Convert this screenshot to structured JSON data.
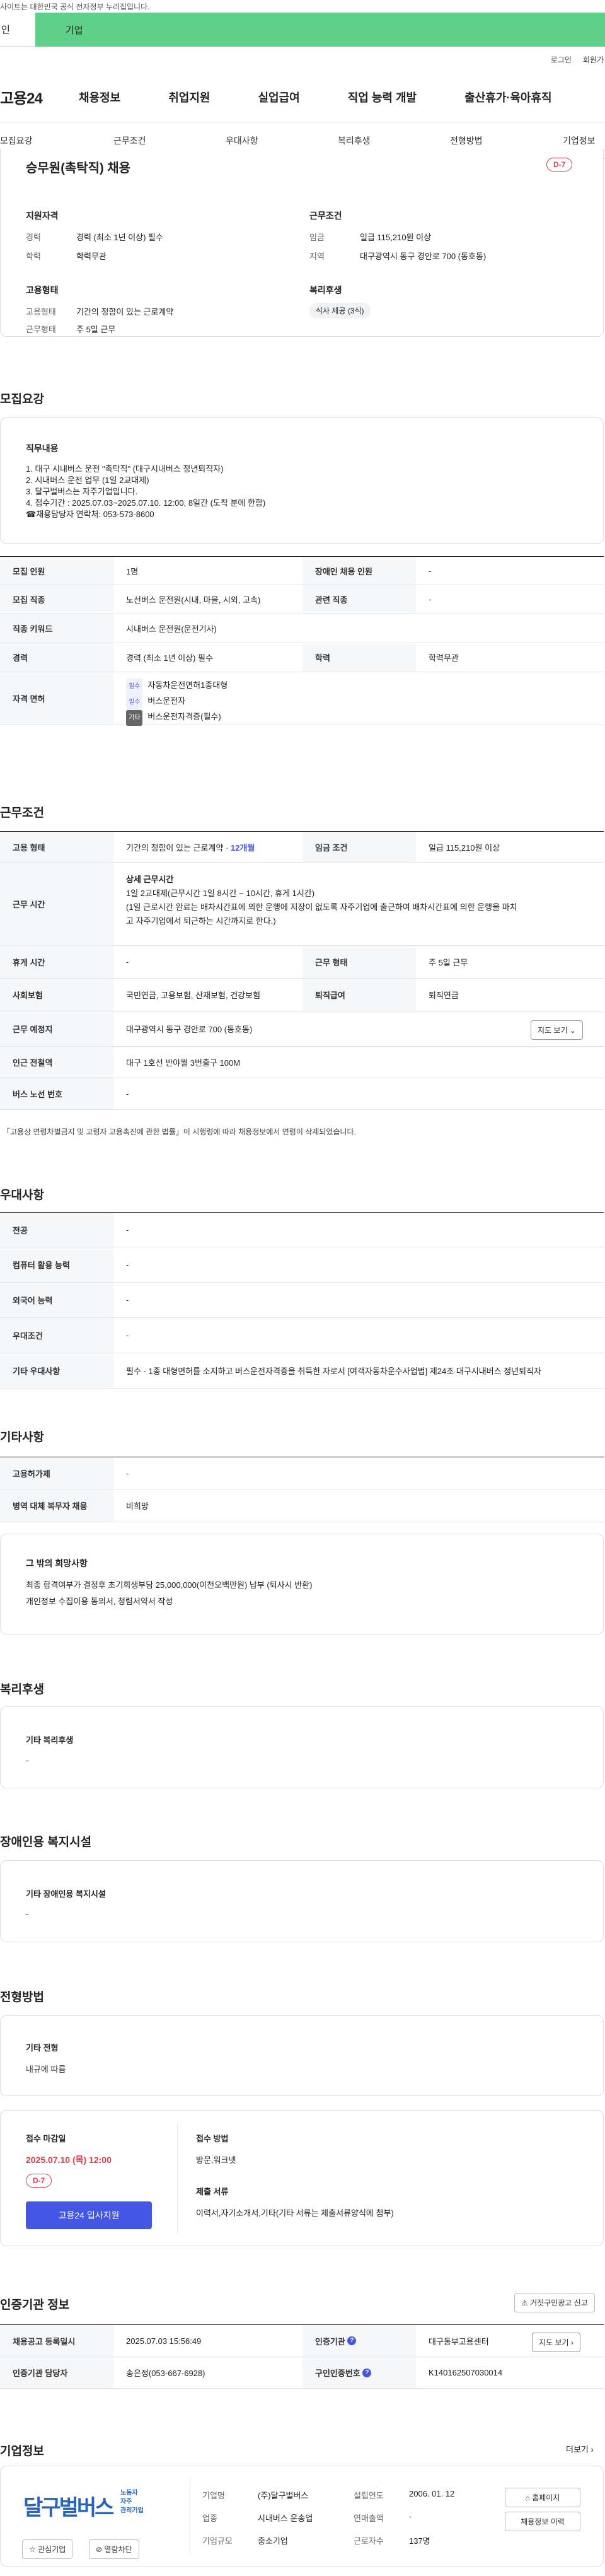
{
  "topbar": {
    "notice": "사이트는 대한민국 공식 전자정부 누리집입니다."
  },
  "sitebar": {
    "left": "인",
    "right": "기업"
  },
  "util": {
    "login": "로그인",
    "join": "회원가"
  },
  "gnb": {
    "logo": "고용24",
    "items": [
      "채용정보",
      "취업지원",
      "실업급여",
      "직업 능력 개발",
      "출산휴가·육아휴직"
    ]
  },
  "tabs": [
    "모집요강",
    "근무조건",
    "우대사항",
    "복리후생",
    "전형방법",
    "기업정보"
  ],
  "summary": {
    "title": "승무원(촉탁직) 채용",
    "dday": "D-7",
    "qual_title": "지원자격",
    "career_label": "경력",
    "career": "경력 (최소 1년 이상) 필수",
    "edu_label": "학력",
    "edu": "학력무관",
    "cond_title": "근무조건",
    "wage_label": "임금",
    "wage": "일급 115,210원 이상",
    "region_label": "지역",
    "region": "대구광역시 동구 경안로 700 (동호동)",
    "emp_title": "고용형태",
    "emp_type_label": "고용형태",
    "emp_type": "기간의 정함이 있는 근로계약",
    "work_label": "근무형태",
    "work": "주 5일 근무",
    "welfare_title": "복리후생",
    "welfare_chip": "식사 제공 (3식)"
  },
  "recruit": {
    "heading": "모집요강",
    "duty_title": "직무내용",
    "duty_lines": [
      "1. 대구 시내버스 운전 \"촉탁직\" (대구시내버스 정년퇴직자)",
      "2. 시내버스 운전 업무 (1일 2교대제)",
      "3. 달구벌버스는 자주기업입니다.",
      "4. 접수기간 : 2025.07.03~2025.07.10. 12:00, 8일간 (도착 분에 한함)",
      "☎채용담당자 연락처: 053-573-8600"
    ],
    "rows": [
      {
        "k": "모집 인원",
        "v": "1명",
        "k2": "장애인 채용 인원",
        "v2": "-"
      },
      {
        "k": "모집 직종",
        "v": "노선버스 운전원(시내, 마을, 시외, 고속)",
        "k2": "관련 직종",
        "v2": "-"
      },
      {
        "k": "직종 키워드",
        "v": "시내버스 운전원(운전기사)"
      },
      {
        "k": "경력",
        "v": "경력 (최소 1년 이상) 필수",
        "k2": "학력",
        "v2": "학력무관"
      }
    ],
    "license_label": "자격 면허",
    "licenses": [
      {
        "tag": "필수",
        "name": "자동차운전면허1종대형"
      },
      {
        "tag": "필수",
        "name": "버스운전자"
      },
      {
        "tag": "기타",
        "name": "버스운전자격증(필수)"
      }
    ]
  },
  "work": {
    "heading": "근무조건",
    "emp_k": "고용 형태",
    "emp_v": "기간의 정함이 있는 근로계약 · ",
    "emp_months": "12개월",
    "wage_k": "임금 조건",
    "wage_v": "일급 115,210원 이상",
    "time_k": "근무 시간",
    "time_title": "상세 근무시간",
    "time_l1": "1일 2교대제(근무시간 1일 8시간 ~ 10시간, 휴게 1시간)",
    "time_l2": "(1일 근로시간 완료는 배차시간표에 의한 운행에 지장이 없도록 자주기업에 출근하여 배차시간표에 의한 운행을 마치",
    "time_l3": "고 자주기업에서 퇴근하는 시간까지로 한다.)",
    "rest_k": "휴게 시간",
    "rest_v": "-",
    "form_k": "근무 형태",
    "form_v": "주 5일 근무",
    "ins_k": "사회보험",
    "ins_v": "국민연금, 고용보험, 산재보험, 건강보험",
    "ret_k": "퇴직급여",
    "ret_v": "퇴직연금",
    "place_k": "근무 예정지",
    "place_v": "대구광역시 동구 경안로 700 (동호동)",
    "map_btn": "지도 보기",
    "station_k": "인근 전철역",
    "station_v": "대구 1호선 반야월 3번출구 100M",
    "bus_k": "버스 노선 번호",
    "bus_v": "-",
    "note": "「고용상 연령차별금지 및 고령자 고용촉진에 관한 법률」이 시행령에 따라 채용정보에서 연령이 삭제되었습니다."
  },
  "prefer": {
    "heading": "우대사항",
    "rows": [
      {
        "k": "전공",
        "v": "-"
      },
      {
        "k": "컴퓨터 활용 능력",
        "v": "-"
      },
      {
        "k": "외국어 능력",
        "v": "-"
      },
      {
        "k": "우대조건",
        "v": "-"
      },
      {
        "k": "기타 우대사항",
        "v": "필수 - 1종 대형면허를 소지하고 버스운전자격증을 취득한 자로서 [여객자동차운수사업법] 제24조 대구시내버스 정년퇴직자"
      }
    ]
  },
  "etc": {
    "heading": "기타사항",
    "rows": [
      {
        "k": "고용허가제",
        "v": "-"
      },
      {
        "k": "병역 대체 복무자 채용",
        "v": "비희망"
      }
    ],
    "wish_title": "그 밖의 희망사항",
    "wish_l1": "최종 합격여부가 결정후 초기희생부담 25,000,000(이천오백만원) 납부 (퇴사시 반환)",
    "wish_l2": "개인정보 수집이용 동의서, 청렴서약서 작성"
  },
  "benefit": {
    "heading": "복리후생",
    "title": "기타 복리후생",
    "value": "-"
  },
  "disabled": {
    "heading": "장애인용 복지시설",
    "title": "기타 장애인용 복지시설",
    "value": "-"
  },
  "process": {
    "heading": "전형방법",
    "title": "기타 전형",
    "value": "내규에 따름",
    "deadline_label": "접수 마감일",
    "deadline": "2025.07.10 (목) 12:00",
    "dday": "D-7",
    "apply": "고용24 입사지원",
    "method_label": "접수 방법",
    "method": "방문,워크넷",
    "docs_label": "제출 서류",
    "docs": "이력서,자기소개서,기타(기타 서류는 제출서류양식에 첨부)"
  },
  "cert": {
    "heading": "인증기관 정보",
    "report_btn": "거짓구인광고 신고",
    "reg_k": "채용공고 등록일시",
    "reg_v": "2025.07.03 15:56:49",
    "org_k": "인증기관",
    "org_v": "대구동부고용센터",
    "map_btn": "지도 보기",
    "mgr_k": "인증기관 담당자",
    "mgr_v": "송은정(053-667-6928)",
    "num_k": "구인인증번호",
    "num_v": "K140162507030014"
  },
  "company": {
    "heading": "기업정보",
    "more": "더보기",
    "logo_main": "달구벌버스",
    "logo_sub1": "노동자",
    "logo_sub2": "자주",
    "logo_sub3": "관리기업",
    "name_k": "기업명",
    "name_v": "(주)달구벌버스",
    "est_k": "설립연도",
    "est_v": "2006. 01. 12",
    "biz_k": "업종",
    "biz_v": "시내버스 운송업",
    "sales_k": "연매출액",
    "sales_v": "-",
    "size_k": "기업규모",
    "size_v": "중소기업",
    "emp_k": "근로자수",
    "emp_v": "137명",
    "homepage": "홈페이지",
    "info_move": "채용정보 이력",
    "fav": "관심기업",
    "block": "열람차단"
  },
  "colors": {
    "accent": "#4457e4",
    "dday": "#e23b4e",
    "green": "#5fd08a"
  }
}
